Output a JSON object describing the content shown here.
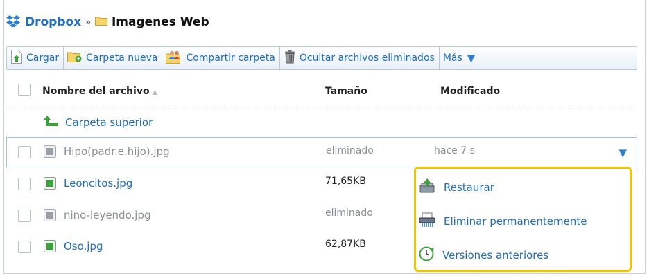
{
  "breadcrumb": {
    "root": "Dropbox",
    "separator": "»",
    "current": "Imagenes Web"
  },
  "toolbar": {
    "upload": "Cargar",
    "new_folder": "Carpeta nueva",
    "share_folder": "Compartir carpeta",
    "hide_deleted": "Ocultar archivos eliminados",
    "more": "Más"
  },
  "table": {
    "col_name": "Nombre del archivo",
    "col_size": "Tamaño",
    "col_modified": "Modificado",
    "parent_folder": "Carpeta superior",
    "rows": [
      {
        "name": "Hipo(padr.e.hijo).jpg",
        "size": "eliminado",
        "modified": "hace 7 s",
        "state": "deleted"
      },
      {
        "name": "Leoncitos.jpg",
        "size": "71,65KB",
        "modified": "",
        "state": "normal"
      },
      {
        "name": "nino-leyendo.jpg",
        "size": "eliminado",
        "modified": "",
        "state": "deleted"
      },
      {
        "name": "Oso.jpg",
        "size": "62,87KB",
        "modified": "",
        "state": "normal"
      }
    ]
  },
  "context_menu": {
    "restore": "Restaurar",
    "delete_permanently": "Eliminar permanentemente",
    "previous_versions": "Versiones anteriores"
  },
  "colors": {
    "link": "#1f6fbf",
    "highlight": "#f2c500",
    "deleted_text": "#8a8f96"
  }
}
